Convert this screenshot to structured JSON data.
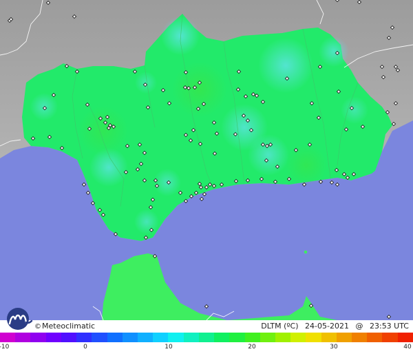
{
  "credit": {
    "symbol": "©",
    "brand": "Meteoclimatic"
  },
  "stamp": {
    "variable": "DLTM (ºC)",
    "date": "24-05-2021",
    "sep": "@",
    "time": "23:53 UTC"
  },
  "scale": {
    "ticks": [
      "-10",
      "0",
      "10",
      "20",
      "30",
      "40"
    ],
    "colors": [
      "#d000d0",
      "#b000e0",
      "#9000f0",
      "#7000ff",
      "#5010ff",
      "#3030ff",
      "#2050ff",
      "#1070ff",
      "#1090ff",
      "#10b0ff",
      "#10d0ff",
      "#10f0f0",
      "#10f0c0",
      "#10f090",
      "#10f060",
      "#20f040",
      "#40f020",
      "#70f010",
      "#a0f000",
      "#d0f000",
      "#f0e000",
      "#f0c000",
      "#f0a000",
      "#f08000",
      "#f06000",
      "#f04000",
      "#f02000"
    ]
  },
  "colors": {
    "sea": "#7b86de",
    "land_outside": "#b5b5b5",
    "land_in": "#22ea6a",
    "africa": "#3eee60",
    "station": "#222222"
  }
}
